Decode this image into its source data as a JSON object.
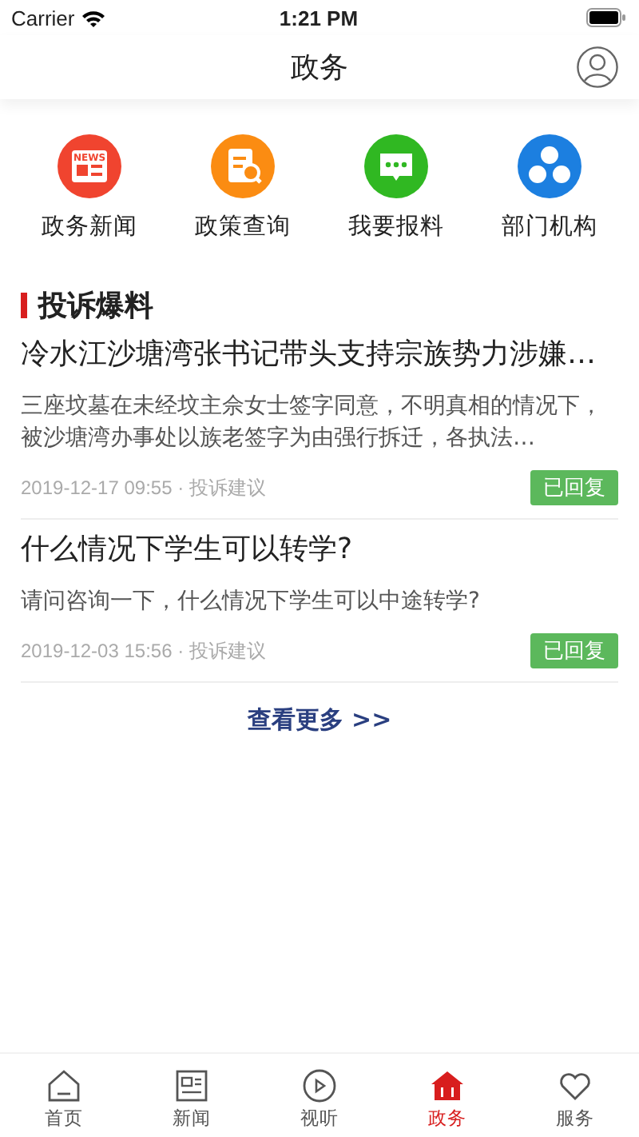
{
  "status_bar": {
    "carrier": "Carrier",
    "time": "1:21 PM"
  },
  "header": {
    "title": "政务"
  },
  "shortcuts": [
    {
      "label": "政务新闻",
      "kind": "news",
      "badge": "NEWS"
    },
    {
      "label": "政策查询",
      "kind": "policy"
    },
    {
      "label": "我要报料",
      "kind": "chat"
    },
    {
      "label": "部门机构",
      "kind": "org"
    }
  ],
  "section": {
    "title": "投诉爆料"
  },
  "reports": [
    {
      "title": "冷水江沙塘湾张书记带头支持宗族势力涉嫌…",
      "summary": "三座坟墓在未经坟主佘女士签字同意，不明真相的情况下，被沙塘湾办事处以族老签字为由强行拆迁，各执法…",
      "meta": "2019-12-17 09:55 · 投诉建议",
      "status": "已回复"
    },
    {
      "title": "什么情况下学生可以转学?",
      "summary": "请问咨询一下，什么情况下学生可以中途转学?",
      "meta": "2019-12-03 15:56 · 投诉建议",
      "status": "已回复"
    }
  ],
  "more_link": "查看更多 >>",
  "tab_bar": [
    {
      "label": "首页",
      "kind": "home",
      "selected": false
    },
    {
      "label": "新闻",
      "kind": "news",
      "selected": false
    },
    {
      "label": "视听",
      "kind": "play",
      "selected": false
    },
    {
      "label": "政务",
      "kind": "gov",
      "selected": true
    },
    {
      "label": "服务",
      "kind": "heart",
      "selected": false
    }
  ]
}
